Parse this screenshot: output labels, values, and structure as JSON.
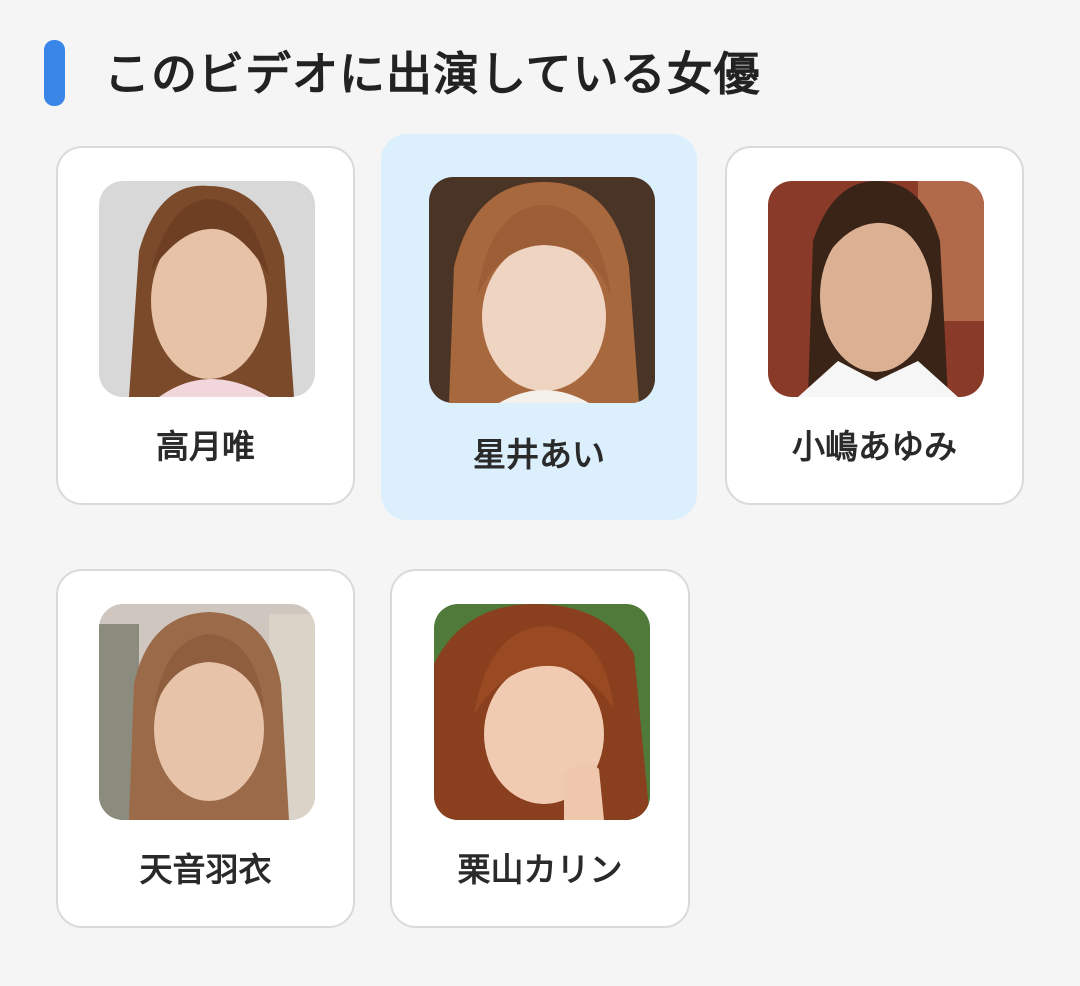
{
  "section": {
    "title": "このビデオに出演している女優",
    "accent_color": "#3a86e8"
  },
  "actresses": [
    {
      "name": "高月唯",
      "selected": false,
      "photo_icon": "portrait-photo"
    },
    {
      "name": "星井あい",
      "selected": true,
      "photo_icon": "portrait-photo"
    },
    {
      "name": "小嶋あゆみ",
      "selected": false,
      "photo_icon": "portrait-photo"
    },
    {
      "name": "天音羽衣",
      "selected": false,
      "photo_icon": "portrait-photo"
    },
    {
      "name": "栗山カリン",
      "selected": false,
      "photo_icon": "portrait-photo"
    }
  ],
  "colors": {
    "selected_card_bg": "#dbeffc",
    "card_border": "#d9d9de"
  }
}
